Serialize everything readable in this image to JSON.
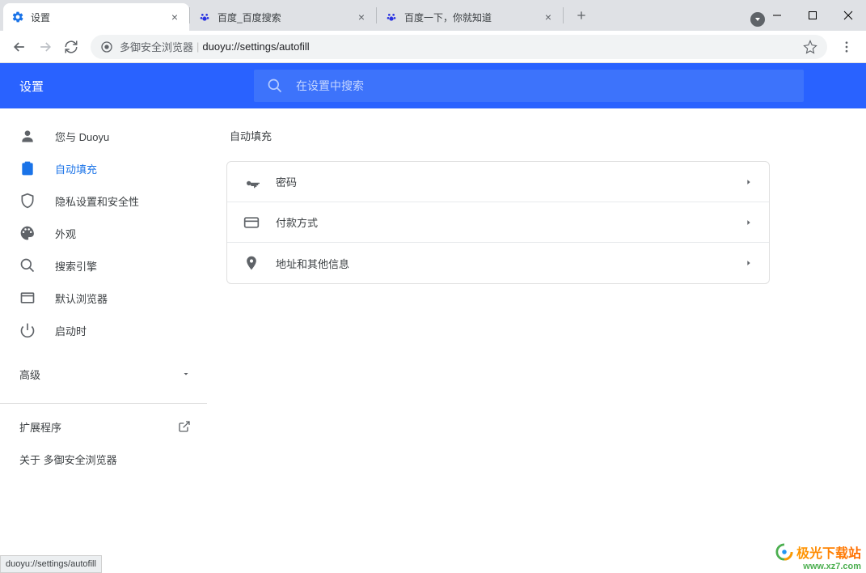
{
  "window": {
    "tabs": [
      {
        "title": "设置",
        "active": true
      },
      {
        "title": "百度_百度搜索",
        "active": false
      },
      {
        "title": "百度一下，你就知道",
        "active": false
      }
    ]
  },
  "toolbar": {
    "site_label": "多御安全浏览器",
    "url": "duoyu://settings/autofill"
  },
  "header": {
    "title": "设置",
    "search_placeholder": "在设置中搜索"
  },
  "sidebar": {
    "items": [
      {
        "label": "您与 Duoyu",
        "icon": "person"
      },
      {
        "label": "自动填充",
        "icon": "clipboard",
        "active": true
      },
      {
        "label": "隐私设置和安全性",
        "icon": "shield"
      },
      {
        "label": "外观",
        "icon": "palette"
      },
      {
        "label": "搜索引擎",
        "icon": "magnify"
      },
      {
        "label": "默认浏览器",
        "icon": "window"
      },
      {
        "label": "启动时",
        "icon": "power"
      }
    ],
    "advanced": "高级",
    "extensions": "扩展程序",
    "about": "关于 多御安全浏览器"
  },
  "content": {
    "title": "自动填充",
    "rows": [
      {
        "label": "密码",
        "icon": "key"
      },
      {
        "label": "付款方式",
        "icon": "card"
      },
      {
        "label": "地址和其他信息",
        "icon": "location"
      }
    ]
  },
  "status": "duoyu://settings/autofill",
  "watermark": {
    "text": "极光下载站",
    "url": "www.xz7.com"
  }
}
